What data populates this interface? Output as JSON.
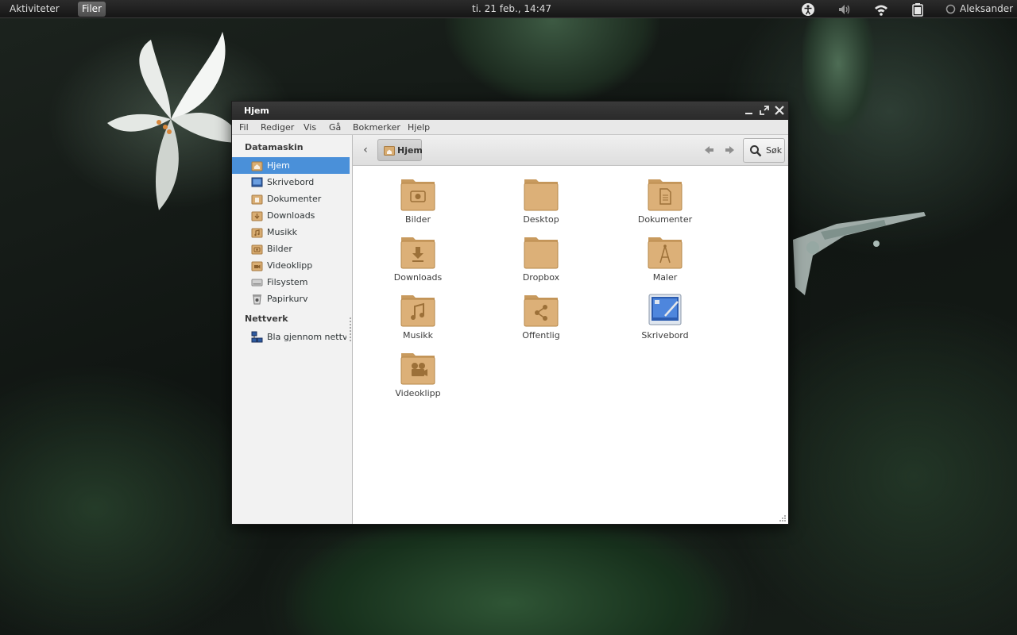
{
  "topbar": {
    "activities": "Aktiviteter",
    "app_menu": "Filer",
    "clock": "ti. 21 feb., 14:47",
    "user": "Aleksander"
  },
  "window": {
    "title": "Hjem",
    "menu": [
      "Fil",
      "Rediger",
      "Vis",
      "Gå",
      "Bokmerker",
      "Hjelp"
    ]
  },
  "sidebar": {
    "sections": [
      {
        "header": "Datamaskin",
        "items": [
          {
            "label": "Hjem",
            "icon": "home-folder-icon",
            "active": true
          },
          {
            "label": "Skrivebord",
            "icon": "desktop-icon"
          },
          {
            "label": "Dokumenter",
            "icon": "documents-folder-icon"
          },
          {
            "label": "Downloads",
            "icon": "downloads-folder-icon"
          },
          {
            "label": "Musikk",
            "icon": "music-folder-icon"
          },
          {
            "label": "Bilder",
            "icon": "pictures-folder-icon"
          },
          {
            "label": "Videoklipp",
            "icon": "videos-folder-icon"
          },
          {
            "label": "Filsystem",
            "icon": "drive-icon"
          },
          {
            "label": "Papirkurv",
            "icon": "trash-icon"
          }
        ]
      },
      {
        "header": "Nettverk",
        "items": [
          {
            "label": "Bla gjennom nettv…",
            "icon": "network-icon"
          }
        ]
      }
    ]
  },
  "toolbar": {
    "breadcrumb": "Hjem",
    "search": "Søk"
  },
  "files": [
    {
      "label": "Bilder",
      "icon": "pictures-folder-icon"
    },
    {
      "label": "Desktop",
      "icon": "folder-icon"
    },
    {
      "label": "Dokumenter",
      "icon": "documents-folder-icon"
    },
    {
      "label": "Downloads",
      "icon": "downloads-folder-icon"
    },
    {
      "label": "Dropbox",
      "icon": "folder-icon"
    },
    {
      "label": "Maler",
      "icon": "templates-folder-icon"
    },
    {
      "label": "Musikk",
      "icon": "music-folder-icon"
    },
    {
      "label": "Offentlig",
      "icon": "public-share-folder-icon"
    },
    {
      "label": "Skrivebord",
      "icon": "desktop-shortcut-icon"
    },
    {
      "label": "Videoklipp",
      "icon": "videos-folder-icon"
    }
  ],
  "colors": {
    "selection": "#4a90d9",
    "folder": "#d9ad72",
    "titlebar": "#2f2f2f"
  }
}
